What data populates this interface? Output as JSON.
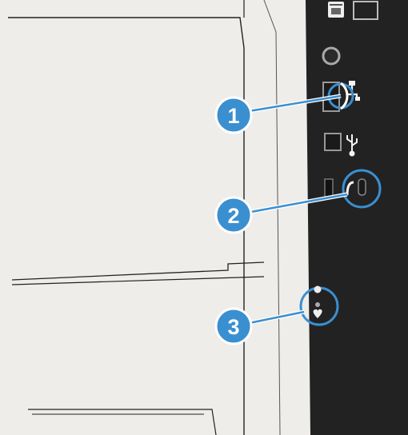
{
  "callouts": [
    {
      "number": "1",
      "target": "ethernet-port-leds"
    },
    {
      "number": "2",
      "target": "security-lock-slot"
    },
    {
      "number": "3",
      "target": "status-leds"
    }
  ],
  "icons": {
    "fax": "fax-icon",
    "network": "network-icon",
    "usb": "usb-icon",
    "lock": "lock-icon",
    "led_top": "led-ready-icon",
    "led_bottom": "led-attention-icon"
  },
  "colors": {
    "callout_blue": "#3a8fd0",
    "callout_border": "#ffffff",
    "printer_body": "#eeedea",
    "panel": "#222222"
  }
}
